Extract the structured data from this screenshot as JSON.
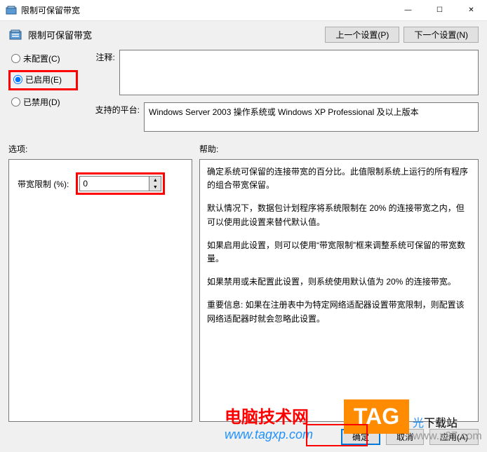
{
  "window": {
    "title": "限制可保留带宽",
    "minimize": "—",
    "maximize": "☐",
    "close": "✕"
  },
  "header": {
    "title": "限制可保留带宽",
    "prev_btn": "上一个设置(P)",
    "next_btn": "下一个设置(N)"
  },
  "radios": {
    "not_configured": "未配置(C)",
    "enabled": "已启用(E)",
    "disabled": "已禁用(D)",
    "selected": "enabled"
  },
  "comment": {
    "label": "注释:",
    "value": ""
  },
  "platform": {
    "label": "支持的平台:",
    "text": "Windows Server 2003 操作系统或 Windows XP Professional 及以上版本"
  },
  "panes": {
    "options_label": "选项:",
    "help_label": "帮助:"
  },
  "option": {
    "bandwidth_label": "带宽限制 (%):",
    "bandwidth_value": "0"
  },
  "help": {
    "p1": "确定系统可保留的连接带宽的百分比。此值限制系统上运行的所有程序的组合带宽保留。",
    "p2": "默认情况下，数据包计划程序将系统限制在 20% 的连接带宽之内，但可以使用此设置来替代默认值。",
    "p3": "如果启用此设置，则可以使用“带宽限制”框来调整系统可保留的带宽数量。",
    "p4": "如果禁用或未配置此设置，则系统使用默认值为 20% 的连接带宽。",
    "p5": "重要信息: 如果在注册表中为特定网络适配器设置带宽限制，则配置该网络适配器时就会忽略此设置。"
  },
  "footer": {
    "ok": "确定",
    "cancel": "取消",
    "apply": "应用(A)"
  },
  "watermarks": {
    "brand1_cn": "电脑技术网",
    "brand1_url": "www.tagxp.com",
    "tag": "TAG",
    "brand2a": "光",
    "brand2b": "下载站",
    "brand2c": "www.x27.com"
  }
}
